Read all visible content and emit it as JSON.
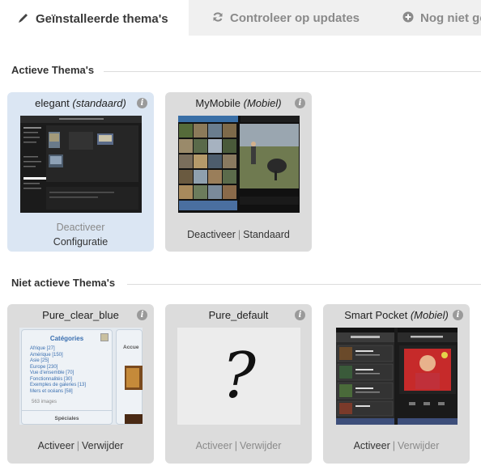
{
  "tabs": [
    {
      "label": "Geïnstalleerde thema's",
      "icon": "pencil-icon",
      "active": true
    },
    {
      "label": "Controleer op updates",
      "icon": "refresh-icon",
      "active": false
    },
    {
      "label": "Nog niet ge",
      "icon": "plus-circle-icon",
      "active": false
    }
  ],
  "active_section": {
    "title": "Actieve Thema's",
    "themes": [
      {
        "name": "elegant",
        "qualifier": "(standaard)",
        "action1": "Deactiveer",
        "action2": "Configuratie"
      },
      {
        "name": "MyMobile",
        "qualifier": "(Mobiel)",
        "action1": "Deactiveer",
        "separator": "|",
        "action2": "Standaard"
      }
    ]
  },
  "inactive_section": {
    "title": "Niet actieve Thema's",
    "themes": [
      {
        "name": "Pure_clear_blue",
        "qualifier": "",
        "action1": "Activeer",
        "separator": "|",
        "action2": "Verwijder",
        "preview": {
          "title": "Catégories",
          "items": [
            "Afrique [27]",
            "Amérique [150]",
            "Asie [25]",
            "Europe [230]",
            "Vue d'ensemble [70]",
            "Fonctionnalités [30]",
            "Exemples de galeries [13]",
            "Mers et océans [58]"
          ],
          "count": "563 images",
          "footer": "Spéciales",
          "side": "Accue"
        }
      },
      {
        "name": "Pure_default",
        "qualifier": "",
        "action1": "Activeer",
        "separator": "|",
        "action2": "Verwijder",
        "placeholder": "?"
      },
      {
        "name": "Smart Pocket",
        "qualifier": "(Mobiel)",
        "action1": "Activeer",
        "separator": "|",
        "action2": "Verwijder"
      }
    ]
  },
  "colors": {
    "active_card_bg": "#dbe6f3",
    "inactive_card_bg": "#dcdcdc",
    "link": "#333333",
    "muted": "#8a8a8a"
  }
}
